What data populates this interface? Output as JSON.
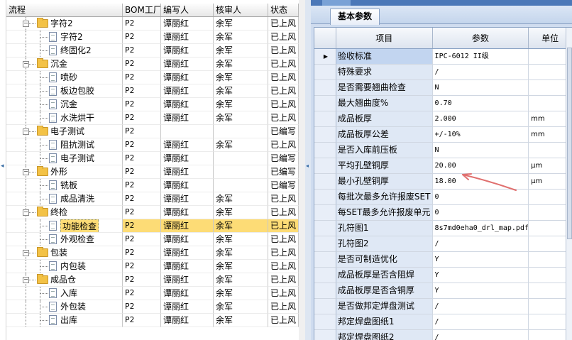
{
  "left_table": {
    "headers": [
      "流程",
      "BOM工厂",
      "编写人",
      "核审人",
      "状态"
    ],
    "rows": [
      {
        "level": 1,
        "type": "folder",
        "expanded": true,
        "name": "字符2",
        "bom": "P2",
        "writer": "谭丽红",
        "reviewer": "余军",
        "status": "已上风"
      },
      {
        "level": 2,
        "type": "doc",
        "name": "字符2",
        "bom": "P2",
        "writer": "谭丽红",
        "reviewer": "余军",
        "status": "已上风"
      },
      {
        "level": 2,
        "type": "doc",
        "name": "终固化2",
        "bom": "P2",
        "writer": "谭丽红",
        "reviewer": "余军",
        "status": "已上风"
      },
      {
        "level": 1,
        "type": "folder",
        "expanded": true,
        "name": "沉金",
        "bom": "P2",
        "writer": "谭丽红",
        "reviewer": "余军",
        "status": "已上风"
      },
      {
        "level": 2,
        "type": "doc",
        "name": "喷砂",
        "bom": "P2",
        "writer": "谭丽红",
        "reviewer": "余军",
        "status": "已上风"
      },
      {
        "level": 2,
        "type": "doc",
        "name": "板边包胶",
        "bom": "P2",
        "writer": "谭丽红",
        "reviewer": "余军",
        "status": "已上风"
      },
      {
        "level": 2,
        "type": "doc",
        "name": "沉金",
        "bom": "P2",
        "writer": "谭丽红",
        "reviewer": "余军",
        "status": "已上风"
      },
      {
        "level": 2,
        "type": "doc",
        "name": "水洗烘干",
        "bom": "P2",
        "writer": "谭丽红",
        "reviewer": "余军",
        "status": "已上风"
      },
      {
        "level": 1,
        "type": "folder",
        "expanded": true,
        "name": "电子测试",
        "bom": "P2",
        "writer": "",
        "reviewer": "",
        "status": "已编写"
      },
      {
        "level": 2,
        "type": "doc",
        "name": "阻抗测试",
        "bom": "P2",
        "writer": "谭丽红",
        "reviewer": "余军",
        "status": "已上风"
      },
      {
        "level": 2,
        "type": "doc",
        "name": "电子测试",
        "bom": "P2",
        "writer": "谭丽红",
        "reviewer": "",
        "status": "已编写"
      },
      {
        "level": 1,
        "type": "folder",
        "expanded": true,
        "name": "外形",
        "bom": "P2",
        "writer": "谭丽红",
        "reviewer": "",
        "status": "已编写"
      },
      {
        "level": 2,
        "type": "doc",
        "name": "铣板",
        "bom": "P2",
        "writer": "谭丽红",
        "reviewer": "",
        "status": "已编写"
      },
      {
        "level": 2,
        "type": "doc",
        "name": "成品清洗",
        "bom": "P2",
        "writer": "谭丽红",
        "reviewer": "余军",
        "status": "已上风"
      },
      {
        "level": 1,
        "type": "folder",
        "expanded": true,
        "name": "终检",
        "bom": "P2",
        "writer": "谭丽红",
        "reviewer": "余军",
        "status": "已上风"
      },
      {
        "level": 2,
        "type": "doc",
        "name": "功能检查",
        "bom": "P2",
        "writer": "谭丽红",
        "reviewer": "余军",
        "status": "已上风",
        "selected": true
      },
      {
        "level": 2,
        "type": "doc",
        "name": "外观检查",
        "bom": "P2",
        "writer": "谭丽红",
        "reviewer": "余军",
        "status": "已上风"
      },
      {
        "level": 1,
        "type": "folder",
        "expanded": true,
        "name": "包装",
        "bom": "P2",
        "writer": "谭丽红",
        "reviewer": "余军",
        "status": "已上风"
      },
      {
        "level": 2,
        "type": "doc",
        "name": "内包装",
        "bom": "P2",
        "writer": "谭丽红",
        "reviewer": "余军",
        "status": "已上风"
      },
      {
        "level": 1,
        "type": "folder",
        "expanded": true,
        "name": "成品仓",
        "bom": "P2",
        "writer": "谭丽红",
        "reviewer": "余军",
        "status": "已上风"
      },
      {
        "level": 2,
        "type": "doc",
        "name": "入库",
        "bom": "P2",
        "writer": "谭丽红",
        "reviewer": "余军",
        "status": "已上风"
      },
      {
        "level": 2,
        "type": "doc",
        "name": "外包装",
        "bom": "P2",
        "writer": "谭丽红",
        "reviewer": "余军",
        "status": "已上风"
      },
      {
        "level": 2,
        "type": "doc",
        "name": "出库",
        "bom": "P2",
        "writer": "谭丽红",
        "reviewer": "余军",
        "status": "已上风"
      }
    ]
  },
  "right_panel": {
    "tab_label": "基本参数",
    "headers": {
      "item": "项目",
      "param": "参数",
      "unit": "单位"
    },
    "rows": [
      {
        "item": "验收标准",
        "param": "IPC-6012 II级",
        "unit": "",
        "current": true
      },
      {
        "item": "特殊要求",
        "param": "/",
        "unit": ""
      },
      {
        "item": "是否需要翘曲检查",
        "param": "N",
        "unit": ""
      },
      {
        "item": "最大翘曲度%",
        "param": "0.70",
        "unit": ""
      },
      {
        "item": "成品板厚",
        "param": "2.000",
        "unit": "mm"
      },
      {
        "item": "成品板厚公差",
        "param": "+/-10%",
        "unit": "mm"
      },
      {
        "item": "是否入库前压板",
        "param": "N",
        "unit": ""
      },
      {
        "item": "平均孔壁铜厚",
        "param": "20.00",
        "unit": "μm"
      },
      {
        "item": "最小孔壁铜厚",
        "param": "18.00",
        "unit": "μm"
      },
      {
        "item": "每批次最多允许报废SET",
        "param": "0",
        "unit": ""
      },
      {
        "item": "每SET最多允许报废单元",
        "param": "0",
        "unit": ""
      },
      {
        "item": "孔符图1",
        "param": "8s7md0eha0_drl_map.pdf",
        "unit": ""
      },
      {
        "item": "孔符图2",
        "param": "/",
        "unit": ""
      },
      {
        "item": "是否可制造优化",
        "param": "Y",
        "unit": ""
      },
      {
        "item": "成品板厚是否含阻焊",
        "param": "Y",
        "unit": ""
      },
      {
        "item": "成品板厚是否含铜厚",
        "param": "Y",
        "unit": ""
      },
      {
        "item": "是否做邦定焊盘测试",
        "param": "/",
        "unit": ""
      },
      {
        "item": "邦定焊盘图纸1",
        "param": "/",
        "unit": ""
      },
      {
        "item": "邦定焊盘图纸2",
        "param": "/",
        "unit": ""
      }
    ]
  },
  "colors": {
    "selected_row": "#fddc76",
    "header_blue": "#4b78b8",
    "annotation_arrow": "#e0706f"
  }
}
